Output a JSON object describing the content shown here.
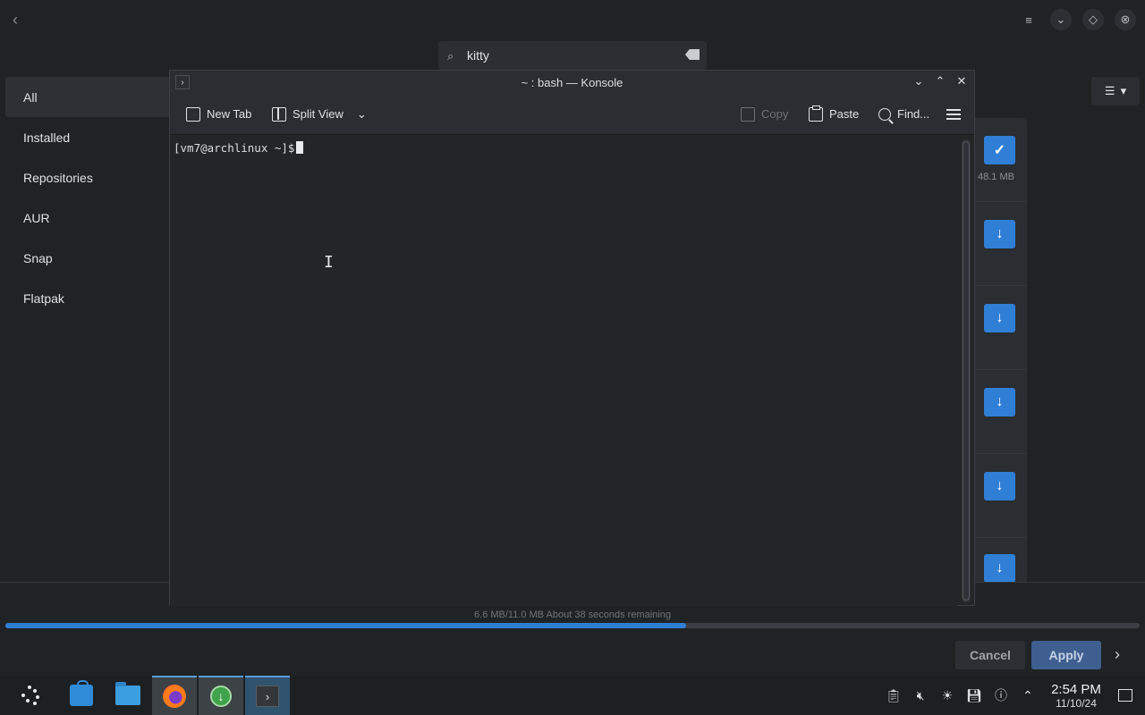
{
  "background_app": {
    "search": {
      "value": "kitty"
    },
    "sidebar": {
      "items": [
        {
          "label": "All",
          "active": true
        },
        {
          "label": "Installed"
        },
        {
          "label": "Repositories"
        },
        {
          "label": "AUR"
        },
        {
          "label": "Snap"
        },
        {
          "label": "Flatpak"
        }
      ]
    },
    "right_panel": {
      "first_size": "48.1 MB"
    },
    "progress": {
      "text": "6.6 MB/11.0 MB About 38 seconds remaining",
      "fraction": 0.6,
      "color": "#2f7fd6"
    },
    "actions": {
      "cancel": "Cancel",
      "apply": "Apply"
    }
  },
  "konsole": {
    "title": "~ : bash — Konsole",
    "toolbar": {
      "new_tab": "New Tab",
      "split_view": "Split View",
      "copy": "Copy",
      "paste": "Paste",
      "find": "Find..."
    },
    "prompt": "[vm7@archlinux ~]$"
  },
  "taskbar": {
    "clock_time": "2:54 PM",
    "clock_date": "11/10/24"
  }
}
